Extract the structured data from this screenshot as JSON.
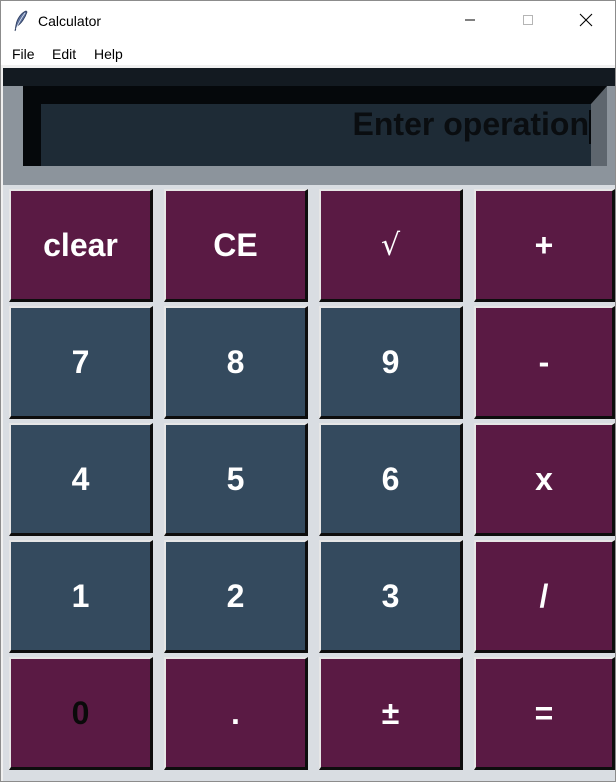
{
  "window": {
    "title": "Calculator",
    "app_icon": "feather-icon",
    "controls": {
      "minimize_icon": "minimize-icon",
      "maximize_icon": "maximize-icon",
      "close_icon": "close-icon"
    }
  },
  "menu": {
    "items": [
      "File",
      "Edit",
      "Help"
    ]
  },
  "display": {
    "value": "Enter operation",
    "colors": {
      "background": "#1e2b36",
      "text": "#0a0d10"
    }
  },
  "keypad": {
    "rows": [
      [
        "clear",
        "CE",
        "√",
        "+"
      ],
      [
        "7",
        "8",
        "9",
        "-"
      ],
      [
        "4",
        "5",
        "6",
        "x"
      ],
      [
        "1",
        "2",
        "3",
        "/"
      ],
      [
        "0",
        ".",
        "±",
        "="
      ]
    ],
    "colors": {
      "function_key": "#5a1a44",
      "digit_key": "#344a5e",
      "label": "#ffffff"
    }
  }
}
